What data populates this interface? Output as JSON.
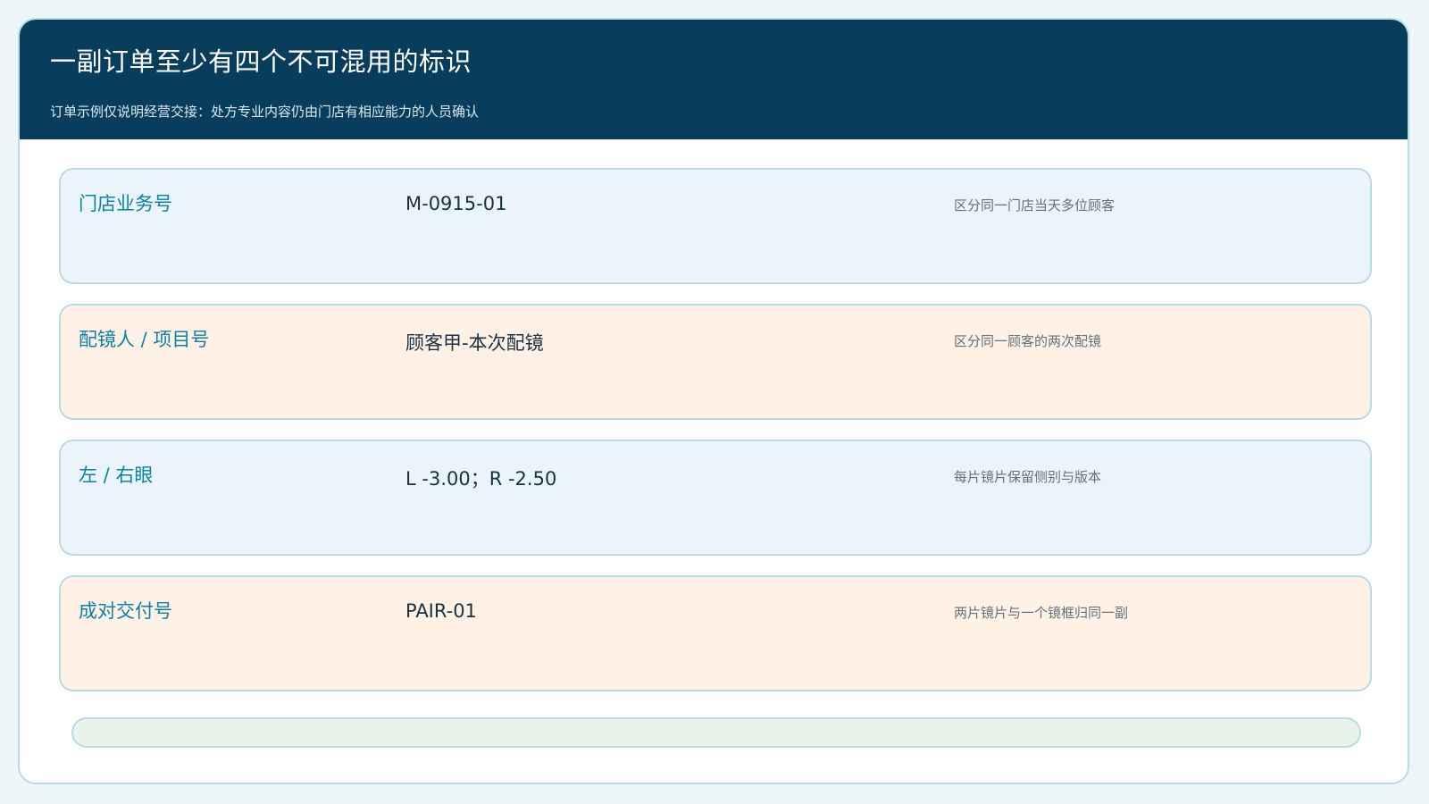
{
  "header": {
    "title": "一副订单至少有四个不可混用的标识",
    "subtitle": "订单示例仅说明经营交接：处方专业内容仍由门店有相应能力的人员确认"
  },
  "rows": [
    {
      "label": "门店业务号",
      "value": "M-0915-01",
      "note": "区分同一门店当天多位顾客"
    },
    {
      "label": "配镜人 / 项目号",
      "value": "顾客甲-本次配镜",
      "note": "区分同一顾客的两次配镜"
    },
    {
      "label": "左 / 右眼",
      "value": "L -3.00；R -2.50",
      "note": "每片镜片保留侧别与版本"
    },
    {
      "label": "成对交付号",
      "value": "PAIR-01",
      "note": "两片镜片与一个镜框归同一副"
    }
  ],
  "colors": {
    "header_bg": "#083e5c",
    "label": "#0b82a8",
    "row_blue": "#eaf4fa",
    "row_peach": "#fff1e6",
    "footer_bar": "#e8f4eb",
    "border": "#b9dbe7"
  }
}
